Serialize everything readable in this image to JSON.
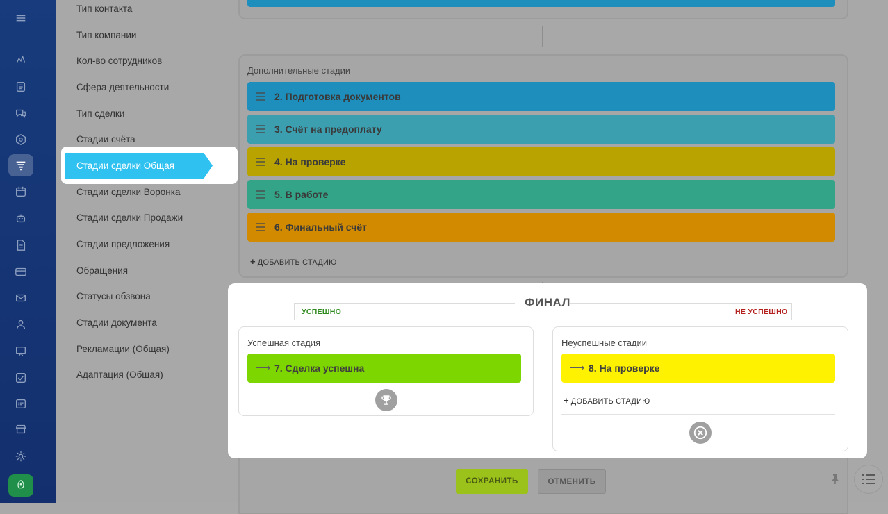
{
  "sidebar_menu": {
    "items": [
      "Тип контакта",
      "Тип компании",
      "Кол-во сотрудников",
      "Сфера деятельности",
      "Тип сделки",
      "Стадии счёта",
      "Стадии сделки Общая",
      "Стадии сделки Воронка",
      "Стадии сделки Продажи",
      "Стадии предложения",
      "Обращения",
      "Статусы обзвона",
      "Стадии документа",
      "Рекламации (Общая)",
      "Адаптация (Общая)"
    ],
    "active": "Стадии сделки Общая"
  },
  "left_icons": [
    "menu-icon",
    "activity-icon",
    "document-icon",
    "chat-icon",
    "hexagon-icon",
    "funnel-icon",
    "calendar-icon",
    "robot-icon",
    "file-icon",
    "card-icon",
    "mail-icon",
    "contacts-icon",
    "presentation-icon",
    "tasks-icon",
    "schedule-icon",
    "store-icon",
    "settings-icon",
    "rocket-icon"
  ],
  "additional": {
    "title": "Дополнительные стадии",
    "stages": [
      {
        "label": "2. Подготовка документов",
        "color": "#1e8fbd"
      },
      {
        "label": "3. Счёт на предоплату",
        "color": "#3c9fb0"
      },
      {
        "label": "4. На проверке",
        "color": "#b9a300"
      },
      {
        "label": "5. В работе",
        "color": "#33a488"
      },
      {
        "label": "6. Финальный счёт",
        "color": "#d28b00"
      }
    ],
    "add_label": "ДОБАВИТЬ СТАДИЮ"
  },
  "final": {
    "title": "ФИНАЛ",
    "success_label": "УСПЕШНО",
    "fail_label": "НЕ УСПЕШНО",
    "success_panel": {
      "title": "Успешная стадия",
      "stage": "7. Сделка успешна",
      "color": "#7ed600"
    },
    "fail_panel": {
      "title": "Неуспешные стадии",
      "stage": "8. На проверке",
      "color": "#fff200",
      "add_label": "ДОБАВИТЬ СТАДИЮ"
    }
  },
  "buttons": {
    "save": "СОХРАНИТЬ",
    "cancel": "ОТМЕНИТЬ"
  }
}
